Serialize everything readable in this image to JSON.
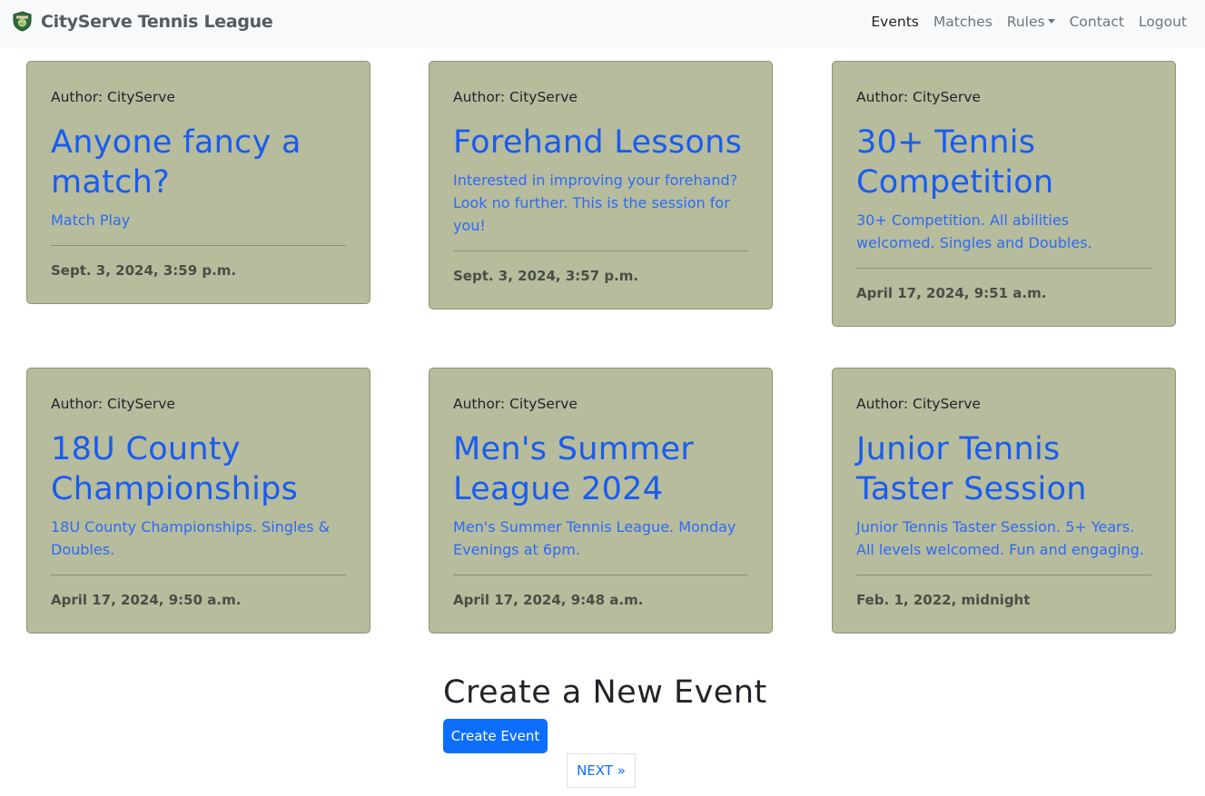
{
  "navbar": {
    "brand": "CityServe Tennis League",
    "logo_icon": "tennis-crest-icon",
    "links": [
      "Events",
      "Matches",
      "Rules",
      "Contact",
      "Logout"
    ],
    "active": "Events"
  },
  "events": [
    {
      "author": "Author: CityServe",
      "title": "Anyone fancy a match?",
      "description": "Match Play",
      "date": "Sept. 3, 2024, 3:59 p.m."
    },
    {
      "author": "Author: CityServe",
      "title": "Forehand Lessons",
      "description": "Interested in improving your forehand? Look no further. This is the session for you!",
      "date": "Sept. 3, 2024, 3:57 p.m."
    },
    {
      "author": "Author: CityServe",
      "title": "30+ Tennis Competition",
      "description": "30+ Competition. All abilities welcomed. Singles and Doubles.",
      "date": "April 17, 2024, 9:51 a.m."
    },
    {
      "author": "Author: CityServe",
      "title": "18U County Championships",
      "description": "18U County Championships. Singles & Doubles.",
      "date": "April 17, 2024, 9:50 a.m."
    },
    {
      "author": "Author: CityServe",
      "title": "Men's Summer League 2024",
      "description": "Men's Summer Tennis League. Monday Evenings at 6pm.",
      "date": "April 17, 2024, 9:48 a.m."
    },
    {
      "author": "Author: CityServe",
      "title": "Junior Tennis Taster Session",
      "description": "Junior Tennis Taster Session. 5+ Years. All levels welcomed. Fun and engaging.",
      "date": "Feb. 1, 2022, midnight"
    }
  ],
  "create": {
    "heading": "Create a New Event",
    "button": "Create Event"
  },
  "pagination": {
    "next": "NEXT »"
  },
  "colors": {
    "card_background": "#b6bc9c",
    "link_blue": "#1a5cf0",
    "primary_button": "#0d6efd",
    "navbar_background": "#f8f9fa"
  }
}
